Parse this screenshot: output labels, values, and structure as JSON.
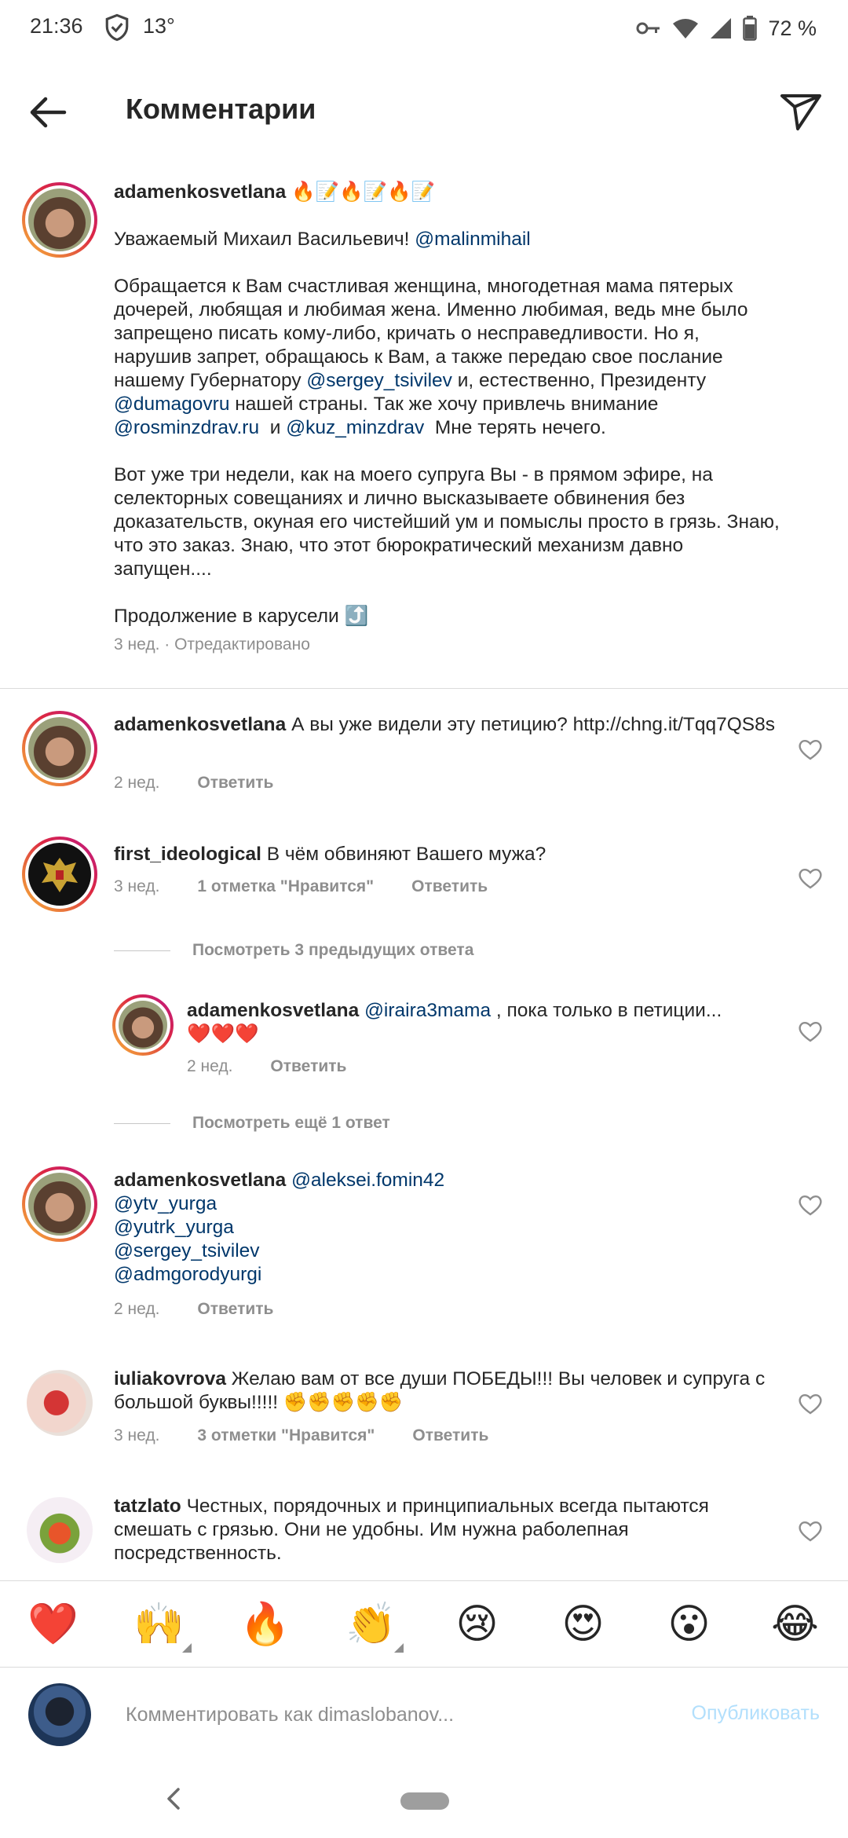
{
  "status_bar": {
    "time": "21:36",
    "temperature": "13°",
    "battery": "72 %"
  },
  "header": {
    "title": "Комментарии"
  },
  "caption": {
    "username": "adamenkosvetlana",
    "username_emoji": "🔥📝🔥📝🔥📝",
    "greeting": "Уважаемый Михаил Васильевич!",
    "greeting_mention": "@malinmihail",
    "p1_a": "Обращается к Вам счастливая женщина, многодетная мама пятерых дочерей, любящая и любимая жена. Именно любимая, ведь мне было запрещено писать кому-либо, кричать о несправедливости. Но я, нарушив запрет, обращаюсь к Вам, а также передаю свое послание нашему Губернатору",
    "p1_m1": "@sergey_tsivilev",
    "p1_b": "и, естественно, Президенту",
    "p1_m2": "@dumagovru",
    "p1_c": "нашей страны. Так же хочу привлечь внимание",
    "p1_m3": "@rosminzdrav.ru",
    "p1_d": "и",
    "p1_m4": "@kuz_minzdrav",
    "p1_e": "Мне терять нечего.",
    "p2": "Вот уже три недели, как на моего супруга Вы - в прямом эфире, на селекторных совещаниях и лично высказываете обвинения без доказательств, окуная его чистейший ум и помыслы просто в грязь. Знаю, что это заказ. Знаю, что этот бюрократический механизм давно запущен....",
    "p3": "Продолжение в карусели ⤴️",
    "meta": "3 нед. · Отредактировано"
  },
  "comments": [
    {
      "username": "adamenkosvetlana",
      "text": "А вы уже видели эту петицию? http://chng.it/Tqq7QS8s",
      "time": "2 нед.",
      "reply": "Ответить"
    },
    {
      "username": "first_ideological",
      "text": "В чём обвиняют Вашего мужа?",
      "time": "3 нед.",
      "likes": "1 отметка \"Нравится\"",
      "reply": "Ответить"
    },
    {
      "username": "adamenkosvetlana",
      "mention": "@aleksei.fomin42",
      "lines": [
        "@ytv_yurga",
        "@yutrk_yurga",
        "@sergey_tsivilev",
        "@admgorodyurgi"
      ],
      "time": "2 нед.",
      "reply": "Ответить"
    },
    {
      "username": "iuliakovrova",
      "text": "Желаю вам от все души ПОБЕДЫ!!! Вы человек и супруга с большой буквы!!!!! ✊✊✊✊✊",
      "time": "3 нед.",
      "likes": "3 отметки \"Нравится\"",
      "reply": "Ответить"
    },
    {
      "username": "tatzlato",
      "text": "Честных, порядочных и принципиальных всегда пытаются смешать с грязью. Они не удобны. Им нужна раболепная посредственность."
    }
  ],
  "view_prev": "Посмотреть 3 предыдущих ответа",
  "reply": {
    "username": "adamenkosvetlana",
    "mention": "@iraira3mama",
    "text": ", пока только в петиции...",
    "hearts": "❤️❤️❤️",
    "time": "2 нед.",
    "reply": "Ответить"
  },
  "view_more": "Посмотреть ещё 1 ответ",
  "emojis": [
    "❤️",
    "🙌",
    "🔥",
    "👏",
    "😢",
    "😍",
    "😮",
    "😂"
  ],
  "input": {
    "placeholder": "Комментировать как dimaslobanov...",
    "publish": "Опубликовать"
  }
}
